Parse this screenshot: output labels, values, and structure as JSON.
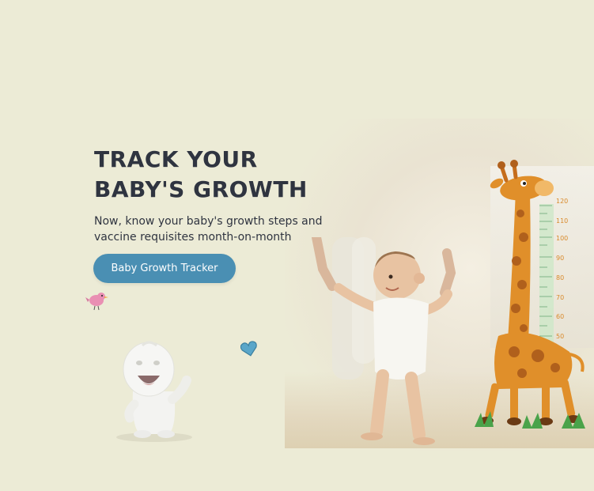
{
  "hero": {
    "headline_line1": "TRACK YOUR",
    "headline_line2": "BABY'S GROWTH",
    "subtitle_line1": "Now, know your baby's growth steps and",
    "subtitle_line2": "vaccine requisites month-on-month",
    "cta_label": "Baby Growth Tracker"
  },
  "height_chart": {
    "ticks": [
      "120",
      "110",
      "100",
      "90",
      "80",
      "70",
      "60",
      "50"
    ]
  },
  "icons": {
    "bird": "bird-icon",
    "heart": "heart-icon",
    "mascot": "mascot-icon",
    "giraffe": "giraffe-height-chart",
    "baby": "baby-walking-photo"
  },
  "colors": {
    "background": "#ecebd6",
    "heading": "#2f3440",
    "cta": "#4a8fb3",
    "giraffe": "#e08f2a"
  }
}
